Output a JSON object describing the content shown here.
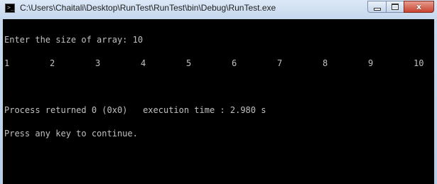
{
  "window": {
    "title": "C:\\Users\\Chaitali\\Desktop\\RunTest\\RunTest\\bin\\Debug\\RunTest.exe",
    "icon": "console-app-icon",
    "controls": {
      "close_glyph": "x"
    }
  },
  "console": {
    "prompt_line": "Enter the size of array: 10",
    "numbers": [
      "1",
      "2",
      "3",
      "4",
      "5",
      "6",
      "7",
      "8",
      "9",
      "10"
    ],
    "process_line": "Process returned 0 (0x0)   execution time : 2.980 s",
    "continue_line": "Press any key to continue.",
    "text_color": "#c0c0c0",
    "background_color": "#000000"
  }
}
